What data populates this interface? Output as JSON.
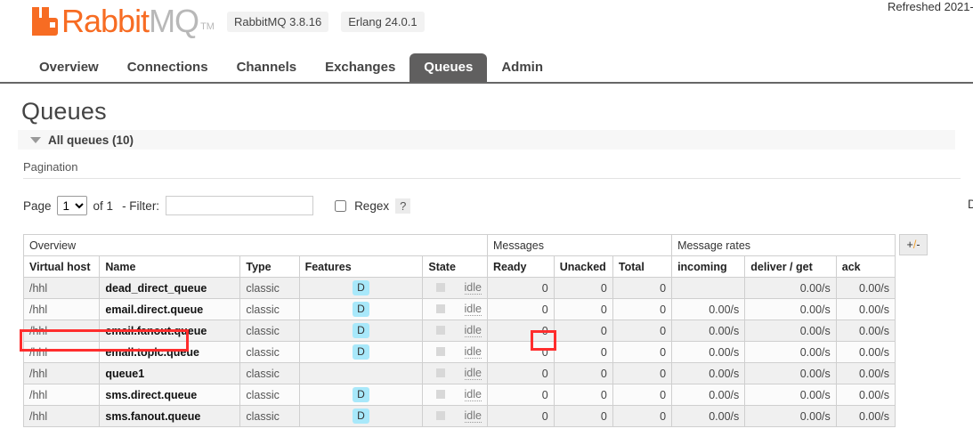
{
  "header": {
    "logo_rabbit": "Rabbit",
    "logo_mq": "MQ",
    "logo_tm": "TM",
    "rabbitmq_version": "RabbitMQ 3.8.16",
    "erlang_version": "Erlang 24.0.1",
    "refreshed": "Refreshed 2021-"
  },
  "nav": {
    "tabs": [
      {
        "label": "Overview",
        "active": false
      },
      {
        "label": "Connections",
        "active": false
      },
      {
        "label": "Channels",
        "active": false
      },
      {
        "label": "Exchanges",
        "active": false
      },
      {
        "label": "Queues",
        "active": true
      },
      {
        "label": "Admin",
        "active": false
      }
    ]
  },
  "page": {
    "title": "Queues",
    "all_queues_label": "All queues (10)"
  },
  "pagination": {
    "section_title": "Pagination",
    "page_label": "Page",
    "page_value": "1",
    "page_options": [
      "1"
    ],
    "of_pages": "of 1",
    "filter_label": "- Filter:",
    "filter_value": "",
    "filter_placeholder": "",
    "regex_label": "Regex",
    "regex_help": "?",
    "regex_checked": false,
    "displaying_cut": "D"
  },
  "table": {
    "group_headers": [
      {
        "label": "Overview",
        "colspan": 5
      },
      {
        "label": "Messages",
        "colspan": 3
      },
      {
        "label": "Message rates",
        "colspan": 3
      }
    ],
    "plus_minus": {
      "plus": "+",
      "slash": "/",
      "minus": "-"
    },
    "columns": [
      "Virtual host",
      "Name",
      "Type",
      "Features",
      "State",
      "Ready",
      "Unacked",
      "Total",
      "incoming",
      "deliver / get",
      "ack"
    ],
    "rows": [
      {
        "vhost": "/hhl",
        "name": "dead_direct_queue",
        "type": "classic",
        "features": "D",
        "state": "idle",
        "ready": "0",
        "unacked": "0",
        "total": "0",
        "incoming": "",
        "deliver_get": "0.00/s",
        "ack": "0.00/s"
      },
      {
        "vhost": "/hhl",
        "name": "email.direct.queue",
        "type": "classic",
        "features": "D",
        "state": "idle",
        "ready": "0",
        "unacked": "0",
        "total": "0",
        "incoming": "0.00/s",
        "deliver_get": "0.00/s",
        "ack": "0.00/s"
      },
      {
        "vhost": "/hhl",
        "name": "email.fanout.queue",
        "type": "classic",
        "features": "D",
        "state": "idle",
        "ready": "0",
        "unacked": "0",
        "total": "0",
        "incoming": "0.00/s",
        "deliver_get": "0.00/s",
        "ack": "0.00/s"
      },
      {
        "vhost": "/hhl",
        "name": "email.topic.queue",
        "type": "classic",
        "features": "D",
        "state": "idle",
        "ready": "0",
        "unacked": "0",
        "total": "0",
        "incoming": "0.00/s",
        "deliver_get": "0.00/s",
        "ack": "0.00/s"
      },
      {
        "vhost": "/hhl",
        "name": "queue1",
        "type": "classic",
        "features": "",
        "state": "idle",
        "ready": "0",
        "unacked": "0",
        "total": "0",
        "incoming": "0.00/s",
        "deliver_get": "0.00/s",
        "ack": "0.00/s"
      },
      {
        "vhost": "/hhl",
        "name": "sms.direct.queue",
        "type": "classic",
        "features": "D",
        "state": "idle",
        "ready": "0",
        "unacked": "0",
        "total": "0",
        "incoming": "0.00/s",
        "deliver_get": "0.00/s",
        "ack": "0.00/s"
      },
      {
        "vhost": "/hhl",
        "name": "sms.fanout.queue",
        "type": "classic",
        "features": "D",
        "state": "idle",
        "ready": "0",
        "unacked": "0",
        "total": "0",
        "incoming": "0.00/s",
        "deliver_get": "0.00/s",
        "ack": "0.00/s"
      }
    ]
  },
  "colors": {
    "brand_orange": "#f76c23",
    "active_tab": "#605f5f",
    "durable_badge": "#a8e8fa",
    "annotation_red": "#ff2d2d"
  }
}
